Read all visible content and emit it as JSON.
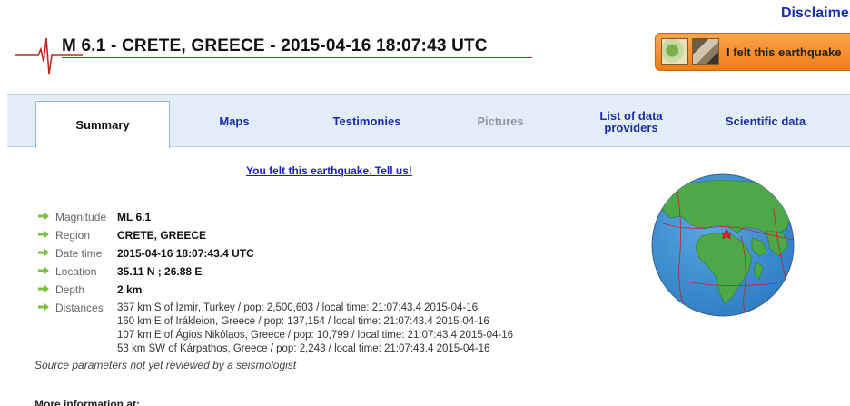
{
  "header": {
    "disclaimer": "Disclaimer",
    "title": "M 6.1 - CRETE, GREECE - 2015-04-16 18:07:43 UTC",
    "felt_button": "I felt this earthquake"
  },
  "tabs": [
    {
      "label": "Summary",
      "state": "active"
    },
    {
      "label": "Maps",
      "state": "normal"
    },
    {
      "label": "Testimonies",
      "state": "normal"
    },
    {
      "label": "Pictures",
      "state": "disabled"
    },
    {
      "label": "List of data providers",
      "state": "normal"
    },
    {
      "label": "Scientific data",
      "state": "normal"
    }
  ],
  "felt_link": "You felt this earthquake. Tell us!",
  "params": {
    "magnitude": {
      "label": "Magnitude",
      "value": "ML 6.1"
    },
    "region": {
      "label": "Region",
      "value": "CRETE, GREECE"
    },
    "datetime": {
      "label": "Date time",
      "value": "2015-04-16 18:07:43.4 UTC"
    },
    "location": {
      "label": "Location",
      "value": "35.11 N ; 26.88 E"
    },
    "depth": {
      "label": "Depth",
      "value": "2 km"
    },
    "distances": {
      "label": "Distances",
      "lines": [
        "367 km S of İzmir, Turkey / pop: 2,500,603 / local time: 21:07:43.4 2015-04-16",
        "160 km E of Irákleion, Greece / pop: 137,154 / local time: 21:07:43.4 2015-04-16",
        "107 km E of Ágios Nikólaos, Greece / pop: 10,799 / local time: 21:07:43.4 2015-04-16",
        "53 km SW of Kárpathos, Greece / pop: 2,243 / local time: 21:07:43.4 2015-04-16"
      ]
    }
  },
  "note": "Source parameters not yet reviewed by a seismologist",
  "more_info": "More information at:",
  "icons": {
    "arrow": "green-right-arrow-icon",
    "logo": "seismogram-icon",
    "globe": "globe-epicenter-icon"
  },
  "colors": {
    "tab_band": "#e3edf8",
    "link": "#1a2ea8",
    "felt_button": "#f58a24",
    "arrow": "#7cc242",
    "title_accent": "#c0261f"
  }
}
